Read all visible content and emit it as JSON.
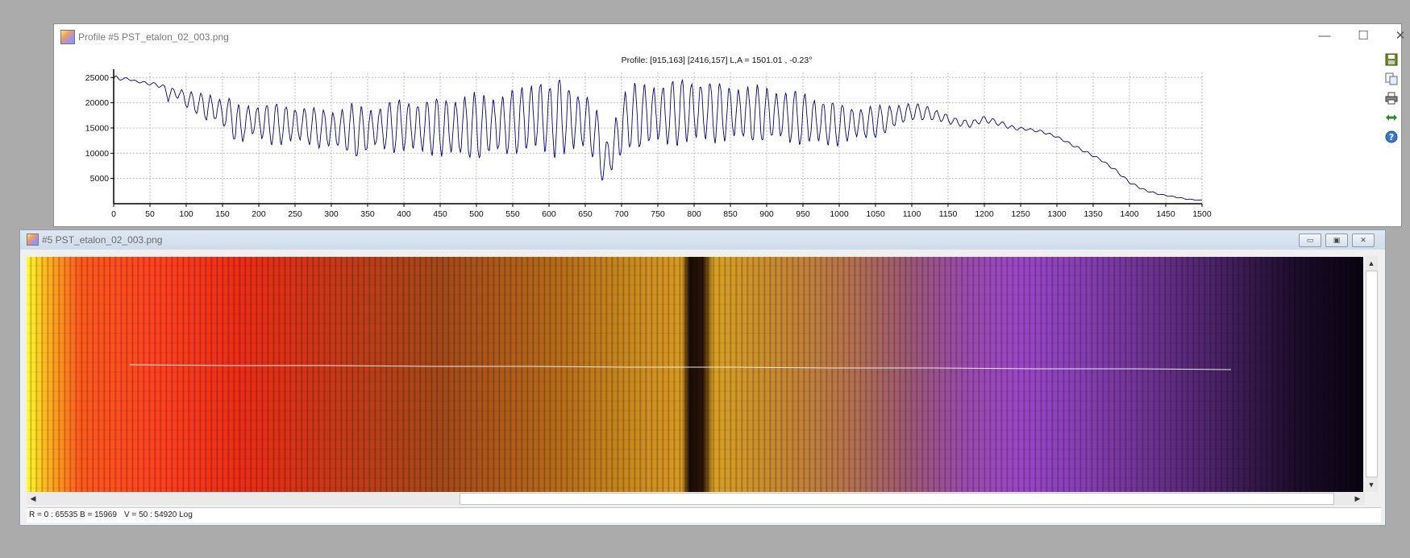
{
  "profile_window": {
    "title": "Profile #5 PST_etalon_02_003.png",
    "controls": {
      "minimize": "—",
      "maximize": "☐",
      "close": "✕"
    },
    "toolbar": [
      "save-icon",
      "copy-icon",
      "print-icon",
      "resize-horizontal-icon",
      "help-icon"
    ]
  },
  "chart_data": {
    "type": "line",
    "title": "Profile: [915,163] [2416,157]  L,A = 1501.01 , -0.23°",
    "xlabel": "",
    "ylabel": "",
    "xlim": [
      0,
      1500
    ],
    "ylim": [
      0,
      26000
    ],
    "x_ticks": [
      "0",
      "50",
      "100",
      "150",
      "200",
      "250",
      "300",
      "350",
      "400",
      "450",
      "500",
      "550",
      "600",
      "650",
      "700",
      "750",
      "800",
      "850",
      "900",
      "950",
      "1000",
      "1050",
      "1100",
      "1150",
      "1200",
      "1250",
      "1300",
      "1350",
      "1400",
      "1450",
      "1500"
    ],
    "y_ticks": [
      "5000",
      "10000",
      "15000",
      "20000",
      "25000"
    ],
    "grid": true,
    "line_color": "#000080",
    "series": [
      {
        "x": [
          0,
          10,
          20,
          30,
          40,
          50,
          60,
          70,
          75,
          80,
          90,
          100,
          110,
          120,
          130,
          140,
          150,
          160,
          170,
          175,
          180,
          190,
          200,
          220,
          240,
          260,
          280,
          300,
          320,
          330,
          340,
          360,
          380,
          400,
          420,
          440,
          460,
          480,
          500,
          520,
          540,
          560,
          580,
          590,
          600,
          610,
          620,
          630,
          640,
          650,
          660,
          670,
          675,
          680,
          685,
          690,
          695,
          700,
          710,
          720,
          730,
          740,
          760,
          780,
          800,
          820,
          840,
          860,
          880,
          900,
          920,
          940,
          960,
          980,
          1000,
          1020,
          1040,
          1060,
          1080,
          1100,
          1120,
          1140,
          1160,
          1180,
          1200,
          1220,
          1240,
          1260,
          1280,
          1300,
          1320,
          1340,
          1360,
          1380,
          1400,
          1420,
          1440,
          1460,
          1480,
          1500
        ],
        "envelope_low": [
          24000,
          24500,
          24500,
          24000,
          23800,
          23500,
          23200,
          22500,
          20000,
          21000,
          20500,
          19000,
          18000,
          17500,
          15500,
          16000,
          15000,
          14500,
          11000,
          9500,
          13000,
          13000,
          12500,
          11500,
          11500,
          12000,
          11000,
          10500,
          10000,
          9000,
          9000,
          10500,
          10000,
          10000,
          9500,
          9500,
          9000,
          8500,
          8500,
          9000,
          9000,
          10000,
          9500,
          9000,
          9500,
          9000,
          9500,
          9000,
          10000,
          10500,
          9000,
          5000,
          4000,
          6000,
          5500,
          5200,
          6000,
          8500,
          10500,
          10500,
          11000,
          11000,
          11000,
          11500,
          11500,
          12000,
          12000,
          12000,
          12000,
          12000,
          12000,
          11500,
          11500,
          11000,
          11500,
          12500,
          12500,
          13500,
          15000,
          16500,
          16500,
          16000,
          15500,
          15000,
          16000,
          15500,
          14500,
          14500,
          14000,
          13000,
          11500,
          10000,
          8500,
          6500,
          4000,
          2500,
          1800,
          1300,
          800,
          600
        ],
        "envelope_high": [
          25500,
          25000,
          25000,
          24500,
          24300,
          24000,
          24000,
          23500,
          23000,
          23200,
          23000,
          22500,
          22000,
          22000,
          22500,
          21500,
          21000,
          21000,
          20500,
          19000,
          20000,
          20000,
          20000,
          20000,
          20000,
          19500,
          19000,
          19000,
          19500,
          20000,
          19500,
          19500,
          20500,
          21000,
          21000,
          21000,
          21500,
          22000,
          22000,
          22000,
          22500,
          23000,
          25500,
          26000,
          23500,
          25500,
          25000,
          24000,
          23000,
          22000,
          21000,
          17000,
          11000,
          13000,
          15000,
          17500,
          20000,
          22500,
          23500,
          24000,
          24000,
          24500,
          24500,
          25000,
          25500,
          24500,
          24000,
          24000,
          23500,
          23500,
          23000,
          22500,
          22000,
          21000,
          20000,
          19500,
          19500,
          19500,
          20000,
          20000,
          19500,
          18500,
          17000,
          16500,
          17500,
          16500,
          15500,
          15000,
          14500,
          13500,
          12000,
          10500,
          9000,
          7000,
          4500,
          3000,
          2000,
          1500,
          1000,
          700
        ],
        "fringe_period_px": 13
      }
    ]
  },
  "image_window": {
    "title": "#5 PST_etalon_02_003.png",
    "controls": {
      "minimize": "▭",
      "restore": "▣",
      "close": "✕"
    },
    "profile_line": {
      "from": [
        915,
        163
      ],
      "to": [
        2416,
        157
      ]
    },
    "scroll_arrows": {
      "up": "▲",
      "down": "▼",
      "left": "◀",
      "right": "▶"
    }
  },
  "status": {
    "r": "R = 0 : 65535",
    "b": "B = 15969",
    "v": "V = 50 : 54920 Log"
  }
}
